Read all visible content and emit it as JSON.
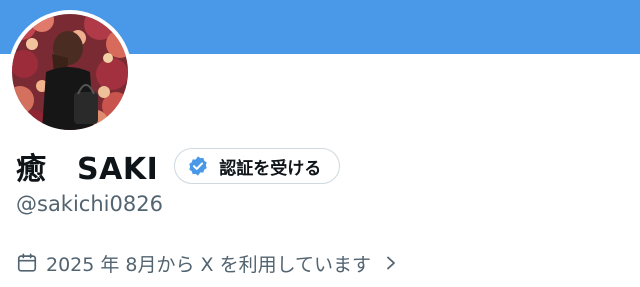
{
  "profile": {
    "display_name": "癒　SAKI",
    "handle": "@sakichi0826",
    "joined": "2025 年 8月から X を利用しています"
  },
  "verify_button": {
    "label": "認証を受ける"
  },
  "colors": {
    "banner": "#4a99e9",
    "verified_badge": "#4a99e9",
    "secondary_text": "#536471",
    "primary_text": "#0f1419"
  },
  "icons": {
    "verified": "verified-badge-icon",
    "calendar": "calendar-icon",
    "chevron": "chevron-right-icon"
  }
}
